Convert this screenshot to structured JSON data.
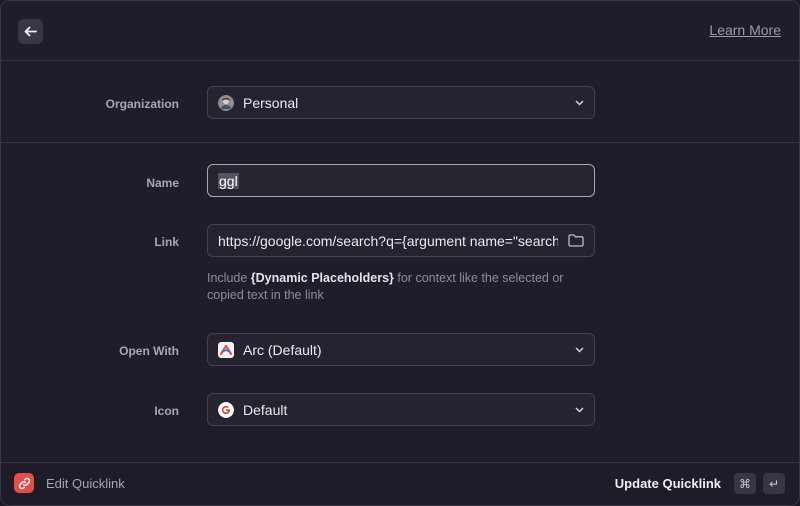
{
  "header": {
    "learn_more": "Learn More"
  },
  "form": {
    "organization": {
      "label": "Organization",
      "value": "Personal"
    },
    "name": {
      "label": "Name",
      "value": "ggl"
    },
    "link": {
      "label": "Link",
      "value": "https://google.com/search?q={argument name=\"search\"}",
      "hint_prefix": "Include ",
      "hint_bold": "{Dynamic Placeholders}",
      "hint_suffix": " for context like the selected or copied text in the link"
    },
    "open_with": {
      "label": "Open With",
      "value": "Arc (Default)"
    },
    "icon": {
      "label": "Icon",
      "value": "Default"
    }
  },
  "footer": {
    "title": "Edit Quicklink",
    "action": "Update Quicklink",
    "shortcut_keys": [
      "⌘",
      "↵"
    ]
  },
  "colors": {
    "accent_red": "#e0504a",
    "background": "#201c2a"
  }
}
